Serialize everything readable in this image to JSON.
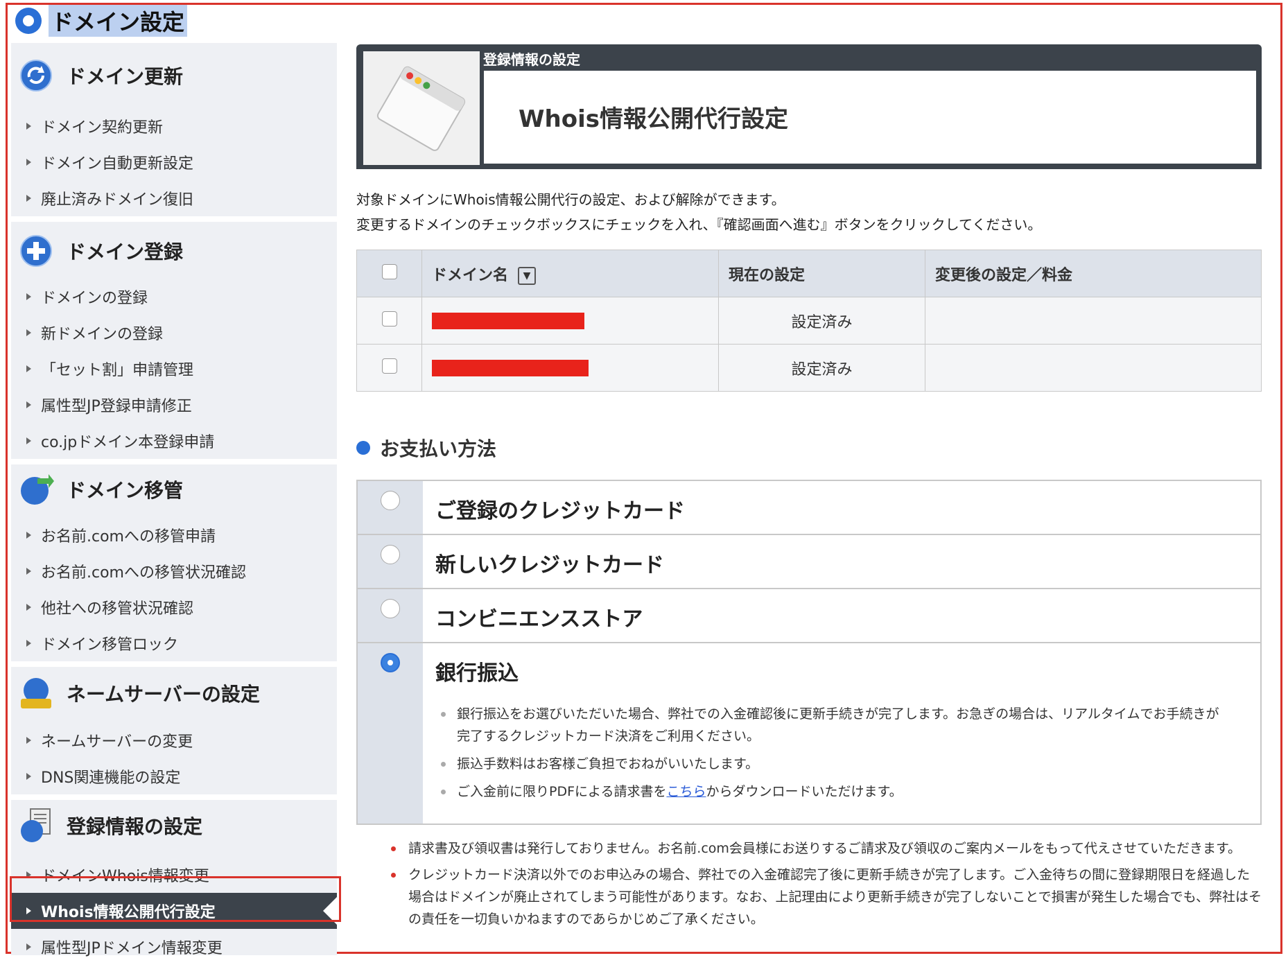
{
  "page_title": "ドメイン設定",
  "sidebar": {
    "sections": [
      {
        "title": "ドメイン更新",
        "icon": "refresh-globe-icon",
        "items": [
          "ドメイン契約更新",
          "ドメイン自動更新設定",
          "廃止済みドメイン復旧"
        ]
      },
      {
        "title": "ドメイン登録",
        "icon": "plus-globe-icon",
        "items": [
          "ドメインの登録",
          "新ドメインの登録",
          "「セット割」申請管理",
          "属性型JP登録申請修正",
          "co.jpドメイン本登録申請"
        ]
      },
      {
        "title": "ドメイン移管",
        "icon": "transfer-globe-icon",
        "items": [
          "お名前.comへの移管申請",
          "お名前.comへの移管状況確認",
          "他社への移管状況確認",
          "ドメイン移管ロック"
        ]
      },
      {
        "title": "ネームサーバーの設定",
        "icon": "nameserver-icon",
        "items": [
          "ネームサーバーの変更",
          "DNS関連機能の設定"
        ]
      },
      {
        "title": "登録情報の設定",
        "icon": "registration-info-icon",
        "items": [
          "ドメインWhois情報変更",
          "Whois情報公開代行設定",
          "属性型JPドメイン情報変更"
        ]
      }
    ],
    "active_item": "Whois情報公開代行設定"
  },
  "header": {
    "label": "登録情報の設定",
    "title": "Whois情報公開代行設定",
    "icon": "browser-window-icon"
  },
  "description": [
    "対象ドメインにWhois情報公開代行の設定、および解除ができます。",
    "変更するドメインのチェックボックスにチェックを入れ、『確認画面へ進む』ボタンをクリックしてください。"
  ],
  "domain_table": {
    "headers": [
      "ドメイン名",
      "現在の設定",
      "変更後の設定／料金"
    ],
    "sort_icon": "sort-down-icon",
    "rows": [
      {
        "current": "設定済み",
        "after": ""
      },
      {
        "current": "設定済み",
        "after": ""
      }
    ]
  },
  "payment": {
    "heading": "お支払い方法",
    "options": [
      "ご登録のクレジットカード",
      "新しいクレジットカード",
      "コンビニエンスストア",
      "銀行振込"
    ],
    "selected": "銀行振込",
    "bank_notes": {
      "note1": "銀行振込をお選びいただいた場合、弊社での入金確認後に更新手続きが完了します。お急ぎの場合は、リアルタイムでお手続きが完了するクレジットカード決済をご利用ください。",
      "note2": "振込手数料はお客様ご負担でおねがいいたします。",
      "note3_pre": "ご入金前に限りPDFによる請求書を",
      "note3_link": "こちら",
      "note3_post": "からダウンロードいただけます。"
    }
  },
  "bottom_notes": [
    "請求書及び領収書は発行しておりません。お名前.com会員様にお送りするご請求及び領収のご案内メールをもって代えさせていただきます。",
    "クレジットカード決済以外でのお申込みの場合、弊社での入金確認完了後に更新手続きが完了します。ご入金待ちの間に登録期限日を経過した場合はドメインが廃止されてしまう可能性があります。なお、上記理由により更新手続きが完了しないことで損害が発生した場合でも、弊社はその責任を一切負いかねますのであらかじめご了承ください。"
  ],
  "colors": {
    "accent_blue": "#2a6fd6",
    "highlight_red": "#d9332b",
    "dark_header": "#3c434b",
    "sidebar_bg": "#eef0f4"
  }
}
